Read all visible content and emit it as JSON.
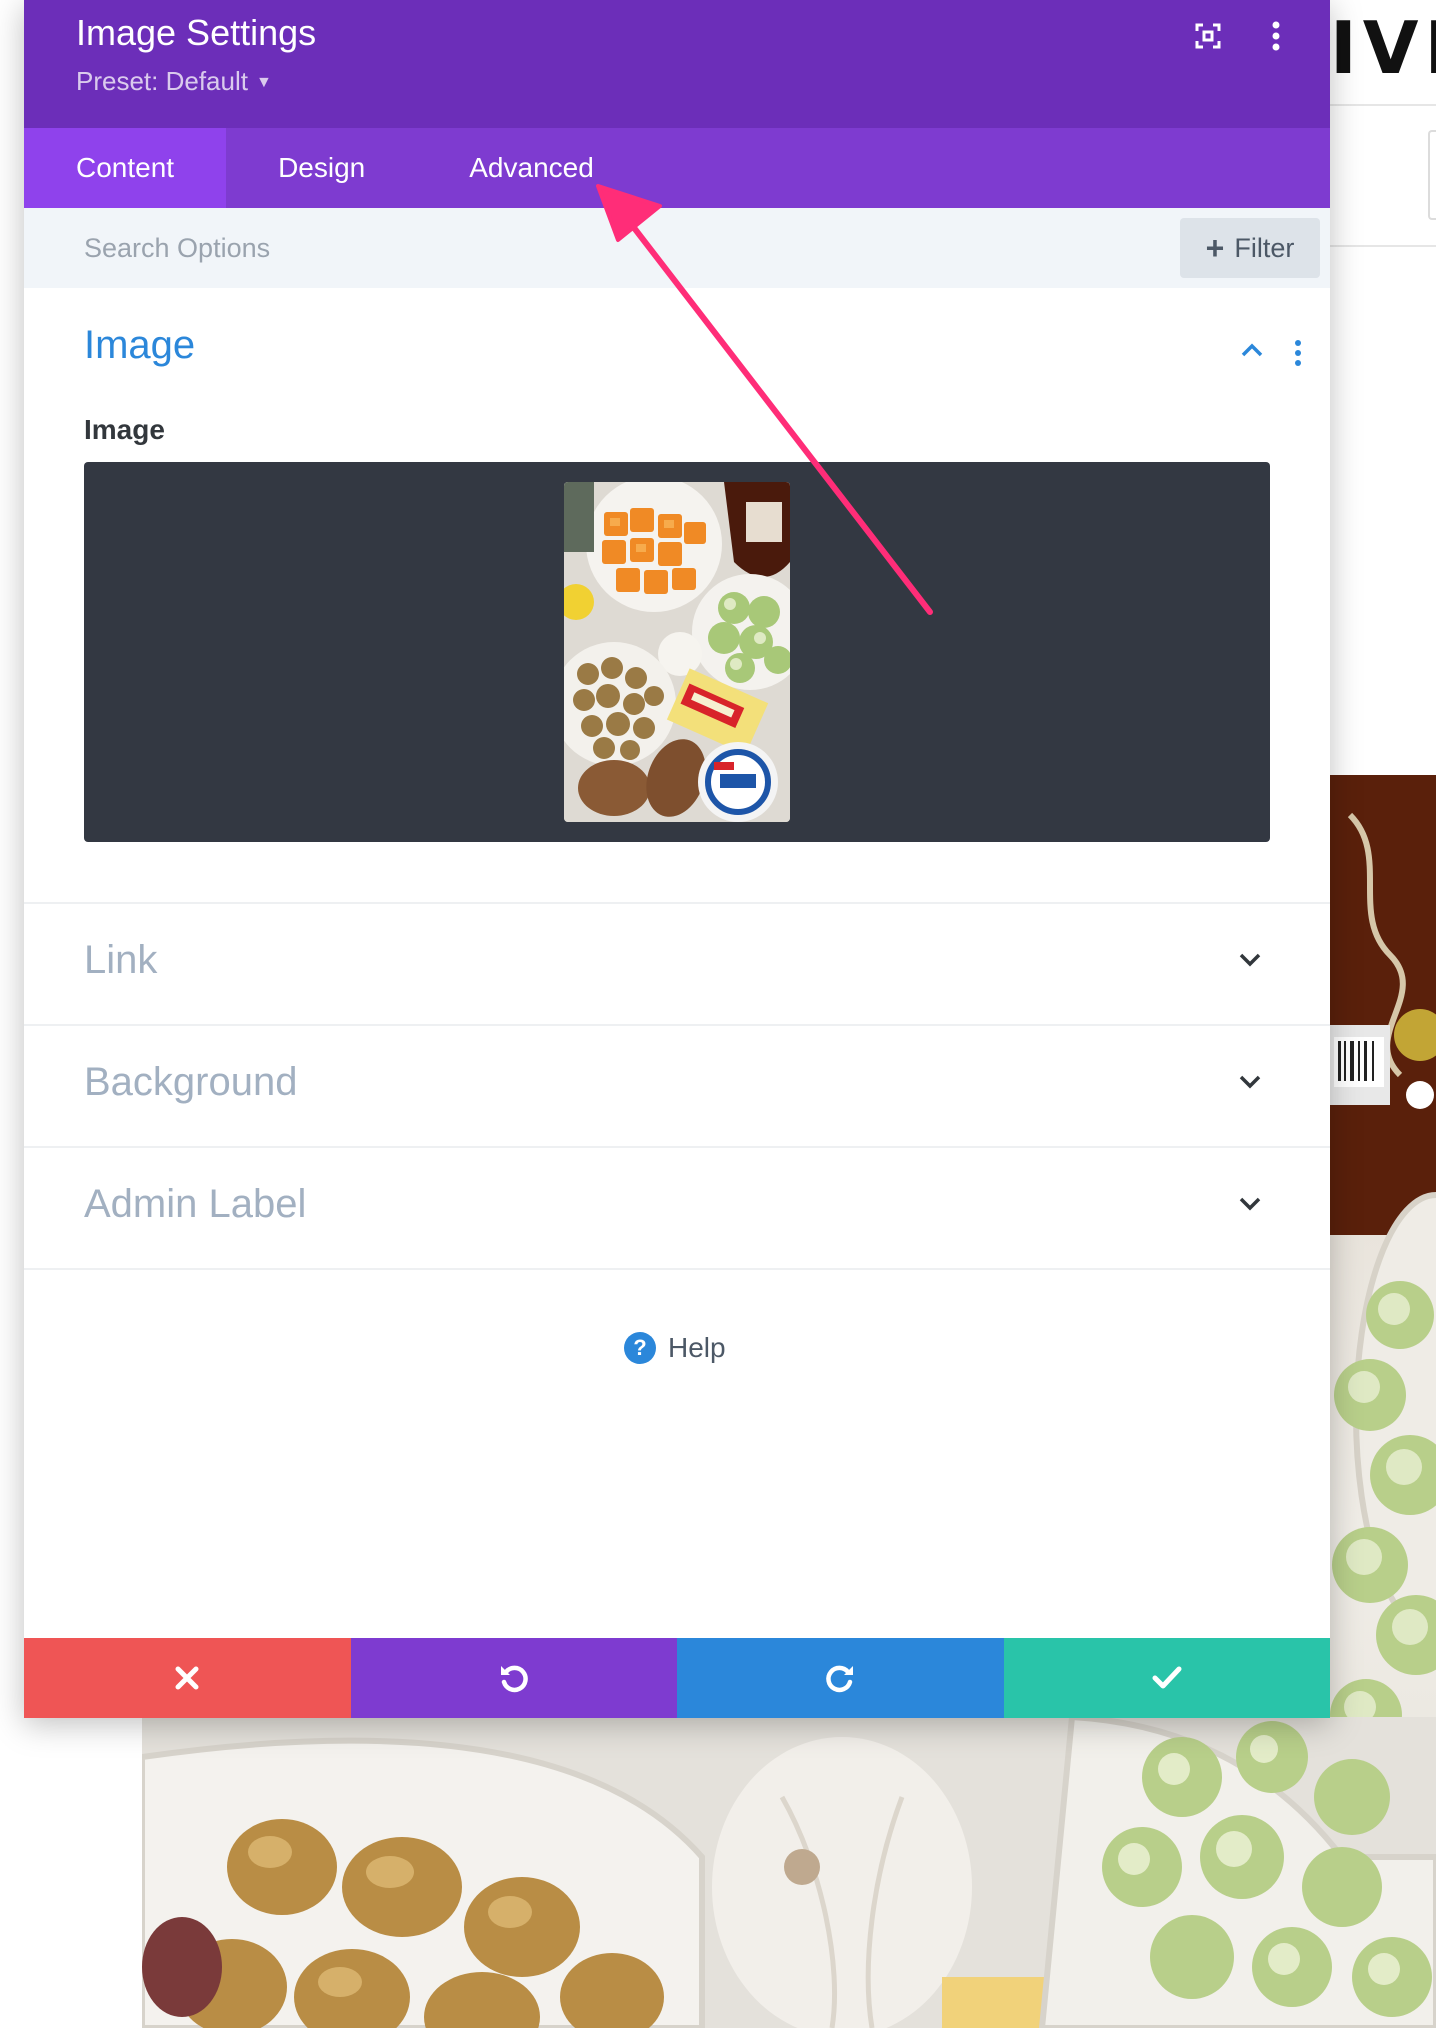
{
  "background": {
    "logo_text": "IVI"
  },
  "modal": {
    "title": "Image Settings",
    "preset_label": "Preset: Default",
    "header_icons": [
      "expand-icon",
      "more-vertical-icon"
    ],
    "tabs": [
      {
        "label": "Content",
        "active": true
      },
      {
        "label": "Design",
        "active": false
      },
      {
        "label": "Advanced",
        "active": false
      }
    ],
    "search": {
      "placeholder": "Search Options",
      "filter_label": "Filter"
    },
    "image_section": {
      "title": "Image",
      "field_label": "Image",
      "expanded": true
    },
    "collapsed_sections": [
      {
        "label": "Link"
      },
      {
        "label": "Background"
      },
      {
        "label": "Admin Label"
      }
    ],
    "help_label": "Help",
    "footer_buttons": [
      {
        "name": "cancel",
        "icon": "close-icon",
        "color": "#ef5555"
      },
      {
        "name": "undo",
        "icon": "undo-icon",
        "color": "#7e3bd0"
      },
      {
        "name": "redo",
        "icon": "redo-icon",
        "color": "#2b87da"
      },
      {
        "name": "save",
        "icon": "check-icon",
        "color": "#29c4a9"
      }
    ]
  },
  "colors": {
    "header": "#6c2eb9",
    "tabs": "#7e3bd0",
    "active_tab": "#8f42ec",
    "accent_blue": "#2b87da",
    "annotation_arrow": "#ff2d78"
  }
}
